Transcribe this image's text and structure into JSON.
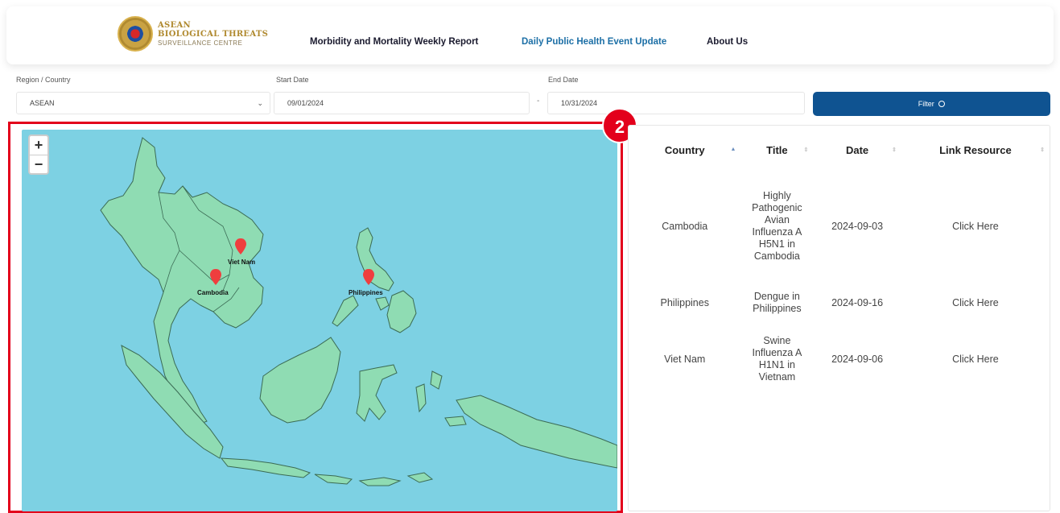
{
  "header": {
    "logo": {
      "line1": "ASEAN",
      "line2": "BIOLOGICAL THREATS",
      "line3": "SURVEILLANCE CENTRE"
    },
    "nav": [
      {
        "label": "Morbidity and Mortality Weekly Report",
        "active": false
      },
      {
        "label": "Daily Public Health Event Update",
        "active": true
      },
      {
        "label": "About Us",
        "active": false
      }
    ]
  },
  "filters": {
    "region": {
      "label": "Region / Country",
      "value": "ASEAN"
    },
    "start": {
      "label": "Start Date",
      "value": "09/01/2024"
    },
    "separator": "-",
    "end": {
      "label": "End Date",
      "value": "10/31/2024"
    },
    "button": "Filter"
  },
  "map": {
    "zoom_in": "+",
    "zoom_out": "−",
    "markers": [
      "Viet Nam",
      "Cambodia",
      "Philippines"
    ]
  },
  "badge": "2",
  "table": {
    "columns": [
      "Country",
      "Title",
      "Date",
      "Link Resource"
    ],
    "rows": [
      {
        "country": "Cambodia",
        "title": [
          "Highly",
          "Pathogenic",
          "Avian",
          "Influenza A",
          "H5N1 in",
          "Cambodia"
        ],
        "date": "2024-09-03",
        "link": "Click Here"
      },
      {
        "country": "Philippines",
        "title": [
          "Dengue in",
          "Philippines"
        ],
        "date": "2024-09-16",
        "link": "Click Here"
      },
      {
        "country": "Viet Nam",
        "title": [
          "Swine",
          "Influenza A",
          "H1N1 in",
          "Vietnam"
        ],
        "date": "2024-09-06",
        "link": "Click Here"
      }
    ]
  },
  "colors": {
    "accent": "#0f5391",
    "active_nav": "#1c6fa6",
    "highlight": "#e3001b",
    "sea": "#7dd1e3",
    "land": "#8fdcb3",
    "marker": "#ef3e3e"
  }
}
